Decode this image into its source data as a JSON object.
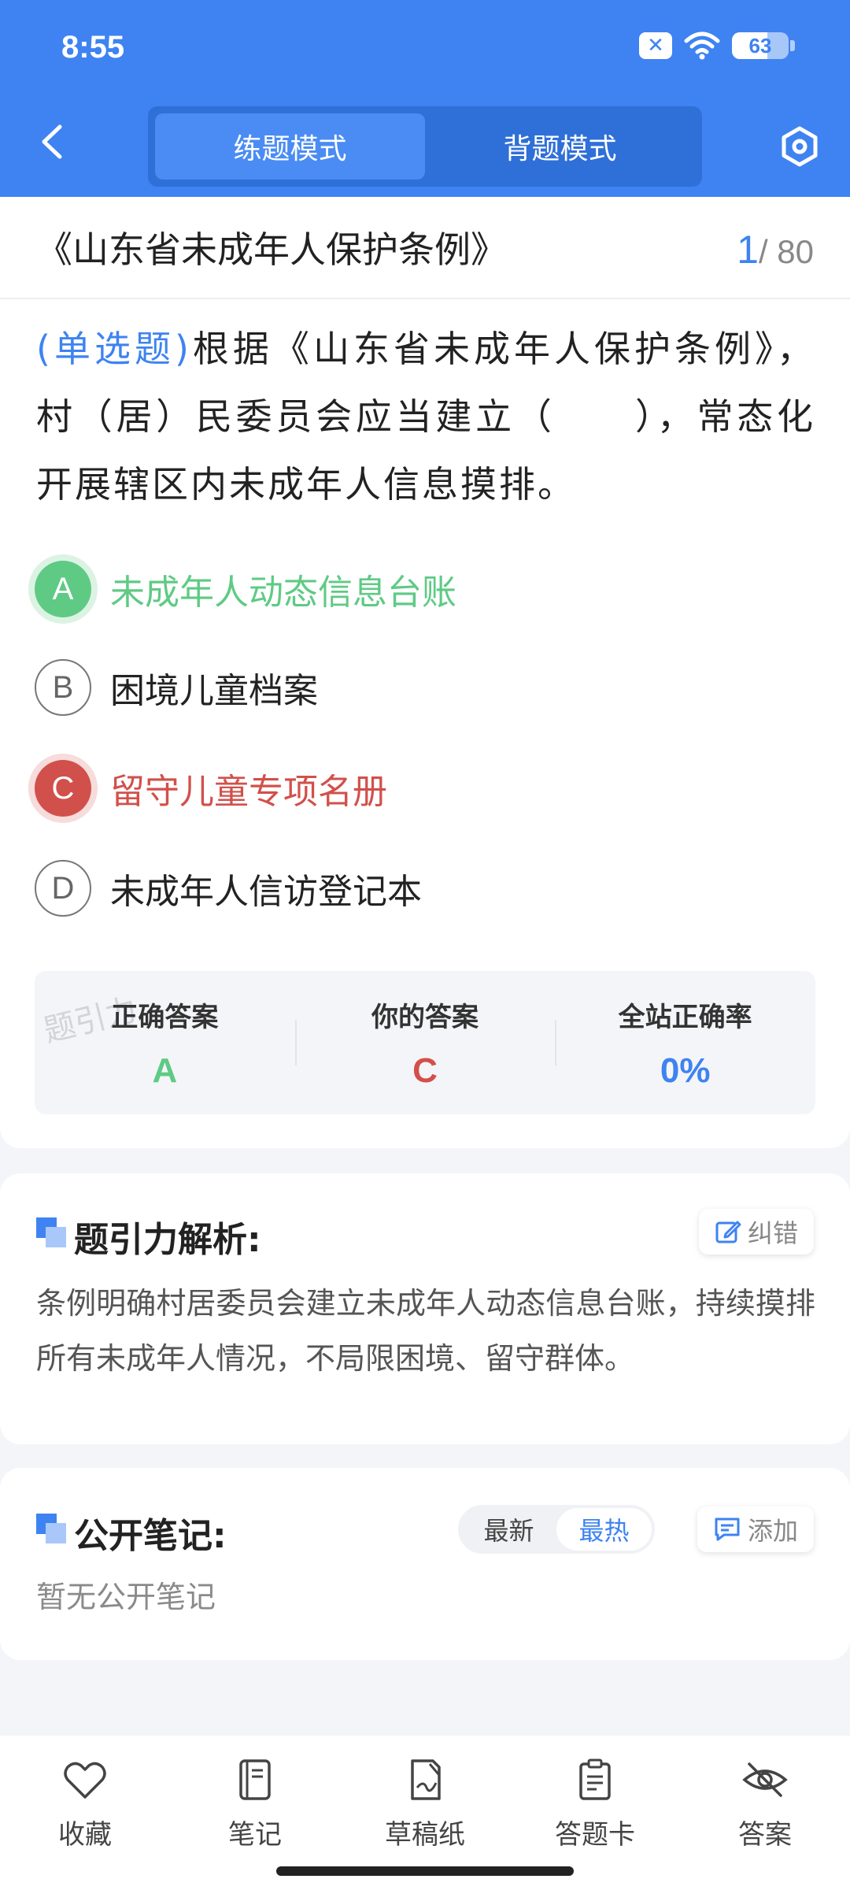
{
  "status": {
    "time": "8:55",
    "battery": "63",
    "battery_level": 0.63
  },
  "header": {
    "tabs": [
      {
        "label": "练题模式",
        "active": true
      },
      {
        "label": "背题模式",
        "active": false
      }
    ]
  },
  "question": {
    "title": "《山东省未成年人保护条例》",
    "current": "1",
    "total": "/ 80",
    "type": "(单选题)",
    "text": "根据《山东省未成年人保护条例》，村（居）民委员会应当建立（　　），常态化开展辖区内未成年人信息摸排。",
    "options": [
      {
        "letter": "A",
        "text": "未成年人动态信息台账",
        "state": "correct"
      },
      {
        "letter": "B",
        "text": "困境儿童档案",
        "state": "none"
      },
      {
        "letter": "C",
        "text": "留守儿童专项名册",
        "state": "wrong"
      },
      {
        "letter": "D",
        "text": "未成年人信访登记本",
        "state": "none"
      }
    ]
  },
  "stats": {
    "watermark": "题引力",
    "correct_label": "正确答案",
    "correct_value": "A",
    "yours_label": "你的答案",
    "yours_value": "C",
    "rate_label": "全站正确率",
    "rate_value": "0%",
    "colors": {
      "correct": "#5fca84",
      "wrong": "#d2504b",
      "accent": "#3e83f1"
    }
  },
  "analysis": {
    "title": "题引力解析:",
    "report_label": "纠错",
    "text": "条例明确村居委员会建立未成年人动态信息台账，持续摸排所有未成年人情况，不局限困境、留守群体。"
  },
  "notes": {
    "title": "公开笔记:",
    "sort_options": [
      {
        "label": "最新",
        "active": false
      },
      {
        "label": "最热",
        "active": true
      }
    ],
    "add_label": "添加",
    "empty_text": "暂无公开笔记"
  },
  "toolbar": [
    {
      "label": "收藏",
      "icon": "heart-icon"
    },
    {
      "label": "笔记",
      "icon": "notebook-icon"
    },
    {
      "label": "草稿纸",
      "icon": "draft-paper-icon"
    },
    {
      "label": "答题卡",
      "icon": "answer-sheet-icon"
    },
    {
      "label": "答案",
      "icon": "eye-off-icon"
    }
  ]
}
